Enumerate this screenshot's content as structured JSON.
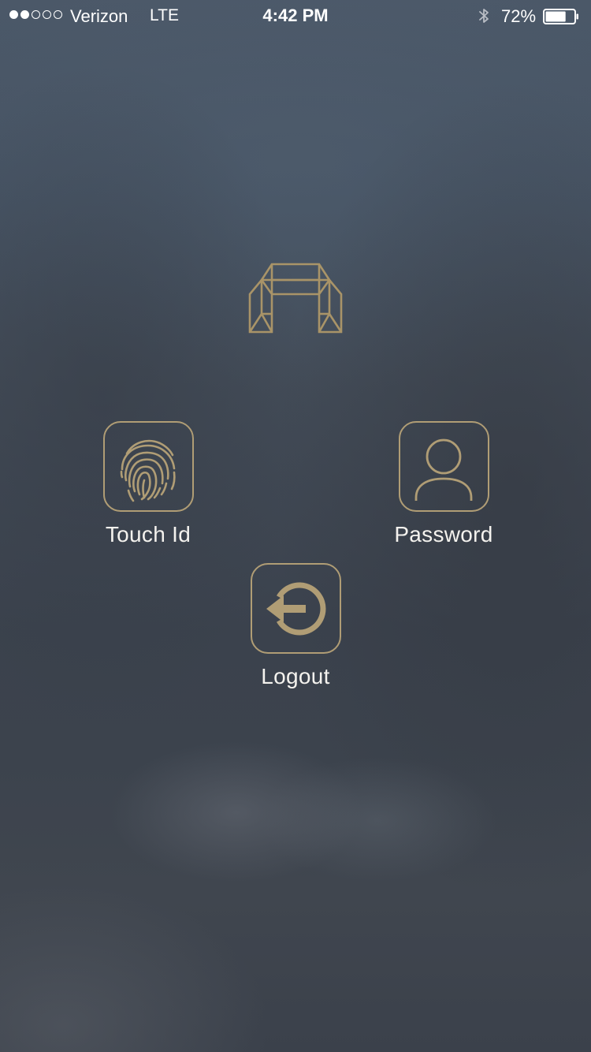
{
  "status_bar": {
    "signal_filled": 2,
    "signal_total": 5,
    "carrier": "Verizon",
    "network": "LTE",
    "time": "4:42 PM",
    "bluetooth_icon": "bluetooth-icon",
    "battery_percent": "72%",
    "battery_level": 0.72
  },
  "logo": {
    "icon": "arch-logo-icon"
  },
  "actions": {
    "touch_id": {
      "label": "Touch Id",
      "icon": "fingerprint-icon"
    },
    "password": {
      "label": "Password",
      "icon": "user-icon"
    },
    "logout": {
      "label": "Logout",
      "icon": "logout-arrow-icon"
    }
  },
  "colors": {
    "accent_gold": "#b09d75",
    "label_text": "#f4f2ee",
    "background": "#414a56"
  }
}
